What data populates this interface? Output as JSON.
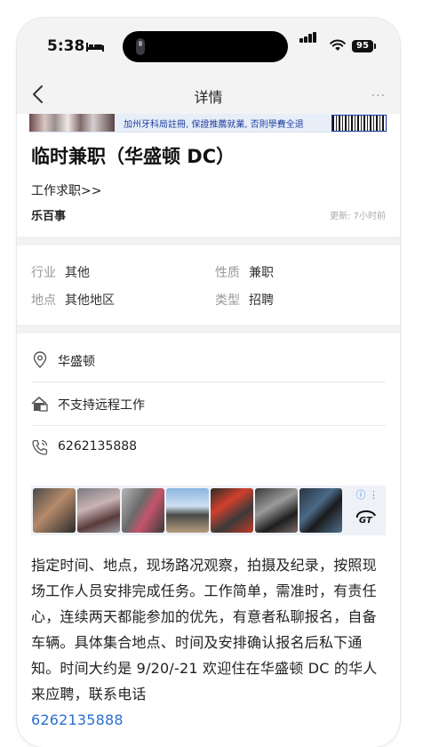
{
  "status_bar": {
    "time": "5:38",
    "battery": "95"
  },
  "nav": {
    "title": "详情",
    "more": "···"
  },
  "banner_ad": {
    "text": "加州牙科局註冊, 保證推薦就業, 否則學費全退"
  },
  "post": {
    "title": "临时兼职（华盛顿 DC）",
    "category_link": "工作求职>>",
    "publisher": "乐百事",
    "updated": "更新: 7小时前"
  },
  "attributes": {
    "industry_label": "行业",
    "industry_value": "其他",
    "nature_label": "性质",
    "nature_value": "兼职",
    "location_label": "地点",
    "location_value": "其他地区",
    "type_label": "类型",
    "type_value": "招聘"
  },
  "contact": {
    "city": "华盛顿",
    "remote": "不支持远程工作",
    "phone": "6262135888"
  },
  "image_ad": {
    "info_icon": "ⓘ",
    "menu_icon": "⋮",
    "thumb_count": 7
  },
  "description": {
    "text": "指定时间、地点，现场路况观察，拍摄及纪录，按照现场工作人员安排完成任务。工作简单，需准时，有责任心，连续两天都能参加的优先，有意者私聊报名，自备车辆。具体集合地点、时间及安排确认报名后私下通知。时间大约是 9/20/-21 欢迎住在华盛顿 DC 的华人来应聘，联系电话",
    "phone": "6262135888"
  },
  "icons": {
    "back": "chevron-left-icon",
    "location": "location-pin-icon",
    "remote": "house-icon",
    "phone": "phone-icon",
    "bed": "bed-icon"
  },
  "colors": {
    "link": "#2a6fd0",
    "section_gap": "#f2f2f2",
    "nav_bg": "#f3f3f4"
  }
}
